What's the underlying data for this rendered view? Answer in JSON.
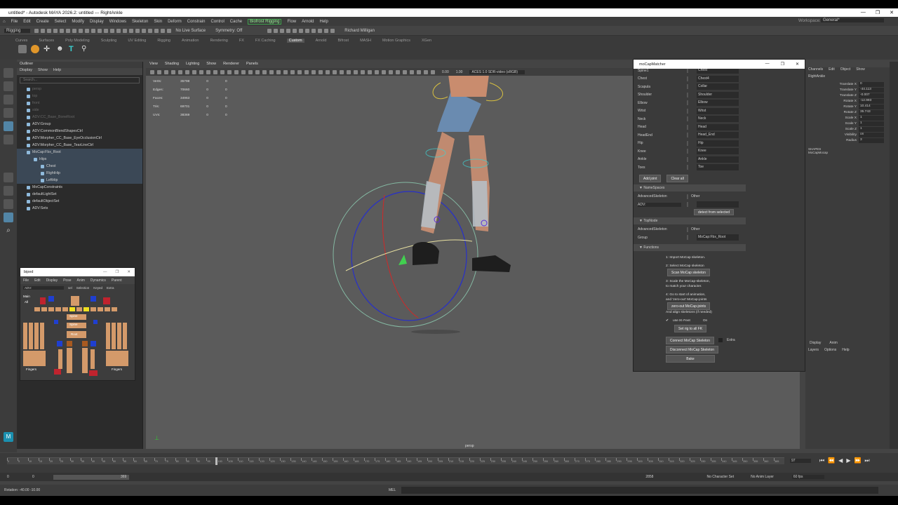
{
  "window": {
    "title": "untitled* - Autodesk MAYA 2026.2: untitled --- RightAnkle",
    "controls": [
      "—",
      "❐",
      "✕"
    ]
  },
  "menubar": {
    "items": [
      "File",
      "Edit",
      "Create",
      "Select",
      "Modify",
      "Display",
      "Windows",
      "Skeleton",
      "Skin",
      "Deform",
      "Constrain",
      "Control",
      "Cache"
    ],
    "highlight": "Biofrost Rigging",
    "items2": [
      "Flow",
      "Arnold",
      "Help"
    ],
    "workspace_label": "Workspace:",
    "workspace_value": "General*"
  },
  "statusline": {
    "mode": "Rigging",
    "live_surface": "No Live Surface",
    "symmetry": "Symmetry: Off",
    "user": "Richard Milligan"
  },
  "shelf": {
    "tabs": [
      "Curves",
      "Surfaces",
      "Poly Modeling",
      "Sculpting",
      "UV Editing",
      "Rigging",
      "Animation",
      "Rendering",
      "FX",
      "FX Caching",
      "Custom",
      "Arnold",
      "Bifrost",
      "MASH",
      "Motion Graphics",
      "XGen"
    ],
    "active_tab": "Custom"
  },
  "outliner": {
    "title": "Outliner",
    "menu": [
      "Display",
      "Show",
      "Help"
    ],
    "search_placeholder": "Search...",
    "rows": [
      {
        "label": "persp",
        "indent": 14,
        "dim": true
      },
      {
        "label": "top",
        "indent": 14,
        "dim": true
      },
      {
        "label": "front",
        "indent": 14,
        "dim": true
      },
      {
        "label": "side",
        "indent": 14,
        "dim": true
      },
      {
        "label": "ADV:CC_Base_BoneRoot",
        "indent": 14,
        "dim": true
      },
      {
        "label": "ADV:Group",
        "indent": 14,
        "dim": false
      },
      {
        "label": "ADV:CommonBlendShapesCtrl",
        "indent": 14,
        "dim": false
      },
      {
        "label": "ADV:Morpher_CC_Base_EyeOcclusionCtrl",
        "indent": 14,
        "dim": false
      },
      {
        "label": "ADV:Morpher_CC_Base_TearLineCtrl",
        "indent": 14,
        "dim": false
      },
      {
        "label": "MoCap:Fbx_Root",
        "indent": 14,
        "dim": false,
        "sel": true
      },
      {
        "label": "Hips",
        "indent": 24,
        "dim": false,
        "sel": true
      },
      {
        "label": "Chest",
        "indent": 34,
        "dim": false,
        "sel": true
      },
      {
        "label": "RightHip",
        "indent": 34,
        "dim": false,
        "sel": true
      },
      {
        "label": "LeftHip",
        "indent": 34,
        "dim": false,
        "sel": true
      },
      {
        "label": "MoCapConstraints",
        "indent": 14,
        "dim": false
      },
      {
        "label": "defaultLightSet",
        "indent": 14,
        "dim": false
      },
      {
        "label": "defaultObjectSet",
        "indent": 14,
        "dim": false
      },
      {
        "label": "ADV:Sets",
        "indent": 14,
        "dim": false
      }
    ]
  },
  "viewport": {
    "menu": [
      "View",
      "Shading",
      "Lighting",
      "Show",
      "Renderer",
      "Panels"
    ],
    "exposure": "0.00",
    "gamma": "1.00",
    "colorspace": "ACES 1.0 SDR-video (sRGB)",
    "camera": "persp",
    "hud": [
      {
        "label": "Verts:",
        "a": "35798",
        "b": "0",
        "c": "0"
      },
      {
        "label": "Edges:",
        "a": "70660",
        "b": "0",
        "c": "0"
      },
      {
        "label": "Faces:",
        "a": "34963",
        "b": "0",
        "c": "0"
      },
      {
        "label": "Tris:",
        "a": "69701",
        "b": "0",
        "c": "0"
      },
      {
        "label": "UVs:",
        "a": "38369",
        "b": "0",
        "c": "0"
      }
    ]
  },
  "biped": {
    "title": "biped",
    "menu": [
      "File",
      "Edit",
      "Display",
      "Pose",
      "Anim",
      "Dynamics",
      "Parent"
    ],
    "namespace": "ADV:",
    "options": [
      "sel",
      "Selection",
      "Keyed",
      "Extra"
    ],
    "labels": {
      "main": "Main",
      "all": "All",
      "spine": "Spine",
      "spine2": "Spine",
      "root": "Root",
      "fingers_l": "Fingers",
      "fingers_r": "Fingers"
    },
    "colors": {
      "red": "#c0232e",
      "blue": "#1f3fd0",
      "yellow": "#f0e020",
      "skin": "#d49a6a",
      "orange": "#a85a20"
    }
  },
  "mocap": {
    "title": "moCapMatcher",
    "joints": [
      {
        "a": "Spine1",
        "b": "Chest"
      },
      {
        "a": "Chest",
        "b": "Chest4"
      },
      {
        "a": "Scapula",
        "b": "Collar"
      },
      {
        "a": "Shoulder",
        "b": "Shoulder"
      },
      {
        "a": "Elbow",
        "b": "Elbow"
      },
      {
        "a": "Wrist",
        "b": "Wrist"
      },
      {
        "a": "Neck",
        "b": "Neck"
      },
      {
        "a": "Head",
        "b": "Head"
      },
      {
        "a": "HeadEnd",
        "b": "Head_End"
      },
      {
        "a": "Hip",
        "b": "Hip"
      },
      {
        "a": "Knee",
        "b": "Knee"
      },
      {
        "a": "Ankle",
        "b": "Ankle"
      },
      {
        "a": "Toes",
        "b": "Toe"
      }
    ],
    "add_joint": "Add joint",
    "clear_all": "Clear all",
    "namespaces_title": "NameSpaces",
    "ns_header_a": "AdvancedSkeleton",
    "ns_header_b": "Other",
    "ns_value_a": "ADV:",
    "ns_value_b": "",
    "detect": "detect from selected",
    "topnode_title": "TopNode",
    "tn_header_a": "AdvancedSkeleton",
    "tn_header_b": "Other",
    "tn_label": "Group",
    "tn_value": "MoCap:Fbx_Root",
    "functions_title": "Functions",
    "step1": "1: Import MoCap skeleton.",
    "step2": "2: Select MoCap skeleton",
    "scan_btn": "Scan MoCap skeleton",
    "step3a": "3: Scale the MoCap-skeleton,",
    "step3b": "to match your character.",
    "step4a": "4: Go to start of animation,",
    "step4b": "and 'zero-out' MoCap-joints",
    "zero_btn": "zero-out MoCap-joints",
    "step4c": "And align skeletons (if needed)",
    "ik_label": "use IK-Feet",
    "ik_on": "On",
    "setrig_btn": "Set rig to all FK",
    "connect_btn": "Connect MoCap Skeleton",
    "extra_label": "Extra",
    "disconnect_btn": "Disconnect MoCap Skeleton",
    "bake_btn": "Bake"
  },
  "channelbox": {
    "menu": [
      "Channels",
      "Edit",
      "Object",
      "Show"
    ],
    "object": "RightAnkle",
    "channels": [
      {
        "l": "Translate X",
        "v": "0"
      },
      {
        "l": "Translate Y",
        "v": "-44.113"
      },
      {
        "l": "Translate Z",
        "v": "-0.007"
      },
      {
        "l": "Rotate X",
        "v": "-12.993"
      },
      {
        "l": "Rotate Y",
        "v": "10.414"
      },
      {
        "l": "Rotate Z",
        "v": "35.743"
      },
      {
        "l": "Scale X",
        "v": "1"
      },
      {
        "l": "Scale Y",
        "v": "1"
      },
      {
        "l": "Scale Z",
        "v": "1"
      },
      {
        "l": "Visibility",
        "v": "on"
      },
      {
        "l": "Radius",
        "v": "3"
      }
    ],
    "shapes_label": "SHAPES",
    "shape_value": "MoCapMocap",
    "layer_menu": [
      "Display",
      "Anim"
    ],
    "layer_menu2": [
      "Layers",
      "Options",
      "Help"
    ]
  },
  "timeline": {
    "start": "0",
    "range_start": "0",
    "range_end": "369",
    "end": "2858",
    "current_frame": "97",
    "no_char_set": "No Character Set",
    "no_anim_layer": "No Anim Layer",
    "fps": "60 fps",
    "tick_labels": [
      "0",
      "5",
      "10",
      "15",
      "20",
      "25",
      "30",
      "35",
      "40",
      "45",
      "50",
      "55",
      "60",
      "65",
      "70",
      "75",
      "80",
      "85",
      "90",
      "95",
      "100",
      "105",
      "110",
      "115",
      "120",
      "125",
      "130",
      "135",
      "140",
      "145",
      "150",
      "155",
      "160",
      "165",
      "170",
      "175",
      "180",
      "185",
      "190",
      "195",
      "200",
      "205",
      "210",
      "215",
      "220",
      "225",
      "230",
      "235",
      "240",
      "245",
      "250",
      "255",
      "260",
      "265",
      "270",
      "275",
      "280",
      "285",
      "290",
      "295",
      "300",
      "305",
      "310",
      "315",
      "320",
      "325",
      "330",
      "335",
      "340",
      "345",
      "350",
      "355",
      "360",
      "365"
    ]
  },
  "cmdline": {
    "status": "Rotation: -40.00 -10.00",
    "mel": "MEL"
  }
}
